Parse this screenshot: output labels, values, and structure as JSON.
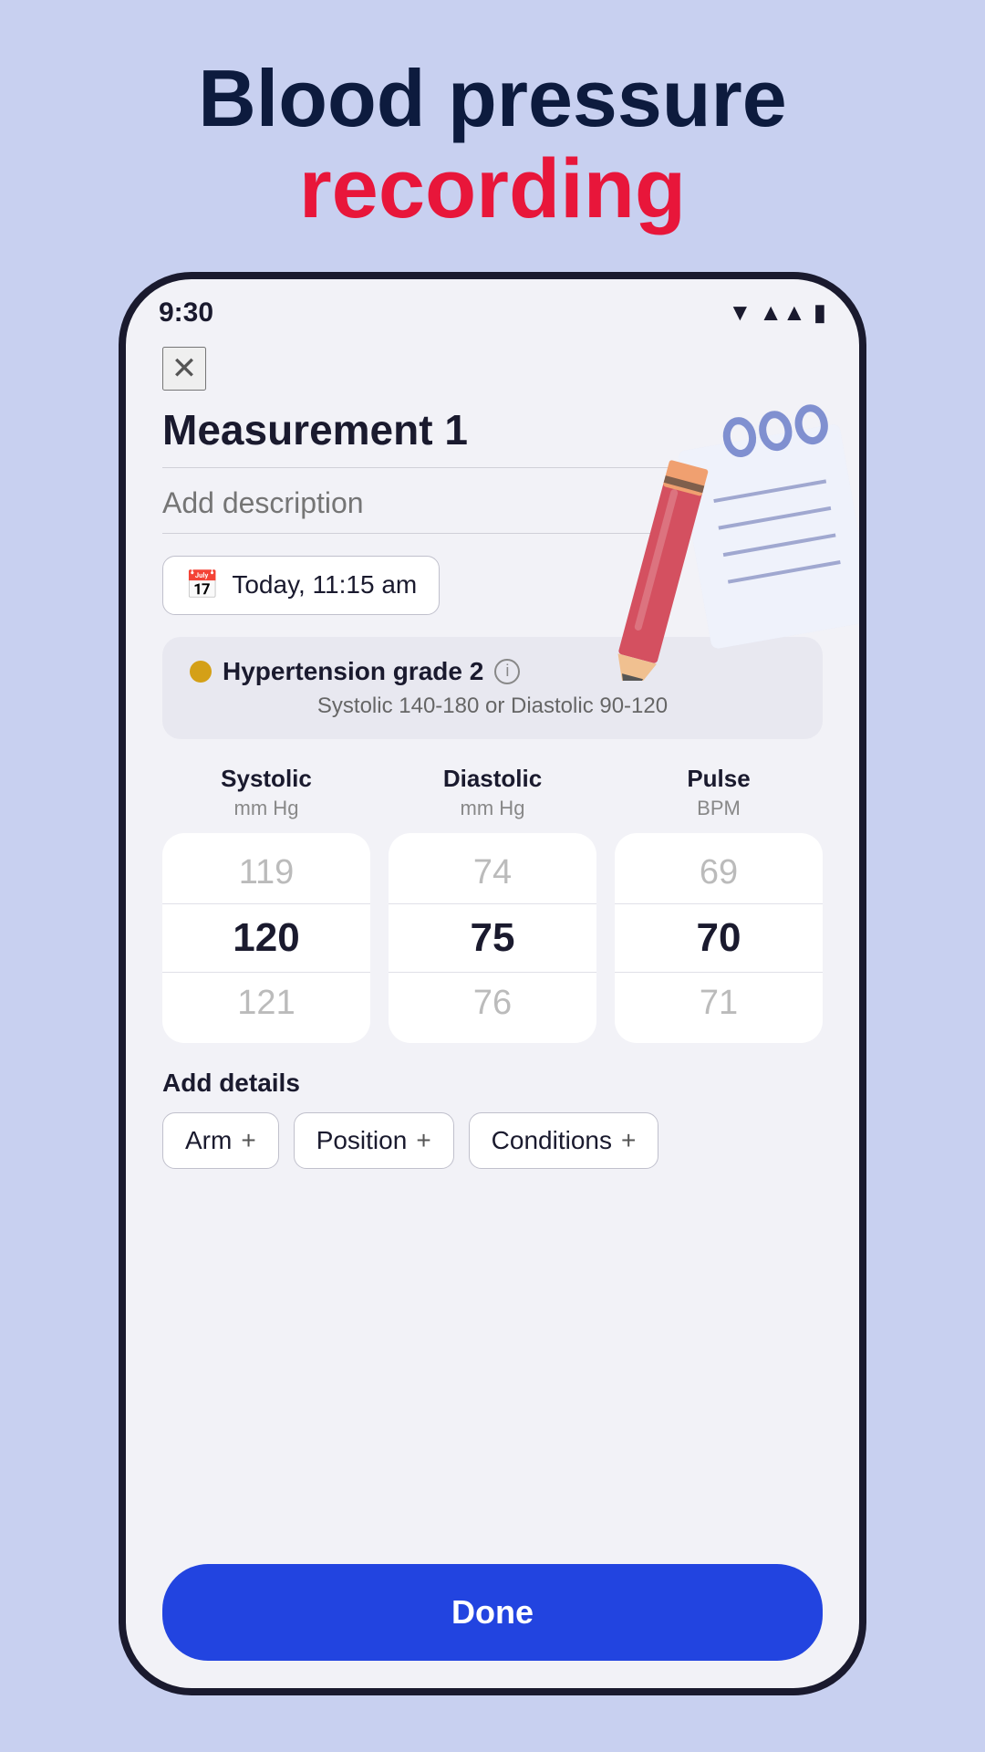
{
  "page": {
    "background_color": "#c8d0f0",
    "title_line1": "Blood pressure",
    "title_line2": "recording"
  },
  "status_bar": {
    "time": "9:30"
  },
  "app": {
    "measurement_title": "Measurement 1",
    "description_placeholder": "Add description",
    "date_label": "Today, 11:15 am",
    "hypertension": {
      "label": "Hypertension grade 2",
      "description": "Systolic 140-180 or Diastolic 90-120"
    },
    "systolic": {
      "label": "Systolic",
      "unit": "mm Hg",
      "values": [
        "119",
        "120",
        "121"
      ],
      "selected_index": 1
    },
    "diastolic": {
      "label": "Diastolic",
      "unit": "mm Hg",
      "values": [
        "74",
        "75",
        "76"
      ],
      "selected_index": 1
    },
    "pulse": {
      "label": "Pulse",
      "unit": "BPM",
      "values": [
        "69",
        "70",
        "71"
      ],
      "selected_index": 1
    },
    "add_details_label": "Add details",
    "chips": [
      {
        "label": "Arm"
      },
      {
        "label": "Position"
      },
      {
        "label": "Conditions"
      }
    ],
    "done_label": "Done"
  }
}
